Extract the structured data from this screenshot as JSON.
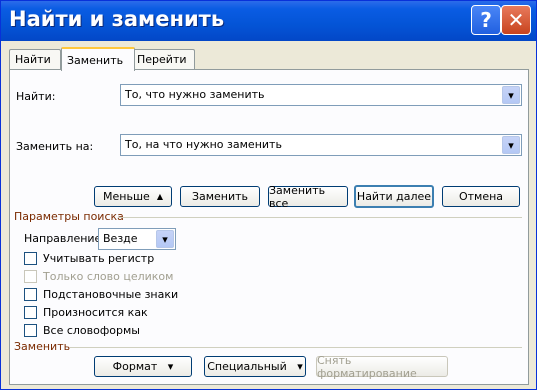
{
  "window": {
    "title": "Найти и заменить",
    "help": "?",
    "close": "✕"
  },
  "tabs": [
    {
      "label": "Найти"
    },
    {
      "label": "Заменить"
    },
    {
      "label": "Перейти"
    }
  ],
  "find": {
    "label": "Найти:",
    "value": "То, что нужно заменить"
  },
  "replace": {
    "label": "Заменить на:",
    "value": "То, на что нужно заменить"
  },
  "buttons": {
    "less": "Меньше",
    "replace": "Заменить",
    "replace_all": "Заменить все",
    "find_next": "Найти далее",
    "cancel": "Отмена"
  },
  "search_options": {
    "title": "Параметры поиска",
    "direction_label": "Направление:",
    "direction_value": "Везде",
    "checkboxes": [
      {
        "label": "Учитывать регистр",
        "enabled": true
      },
      {
        "label": "Только слово целиком",
        "enabled": false
      },
      {
        "label": "Подстановочные знаки",
        "enabled": true
      },
      {
        "label": "Произносится как",
        "enabled": true
      },
      {
        "label": "Все словоформы",
        "enabled": true
      }
    ]
  },
  "replace_section": {
    "title": "Заменить",
    "format": "Формат",
    "special": "Специальный",
    "clear_format": "Снять форматирование"
  },
  "icons": {
    "dropdown": "▾",
    "up": "▲"
  }
}
